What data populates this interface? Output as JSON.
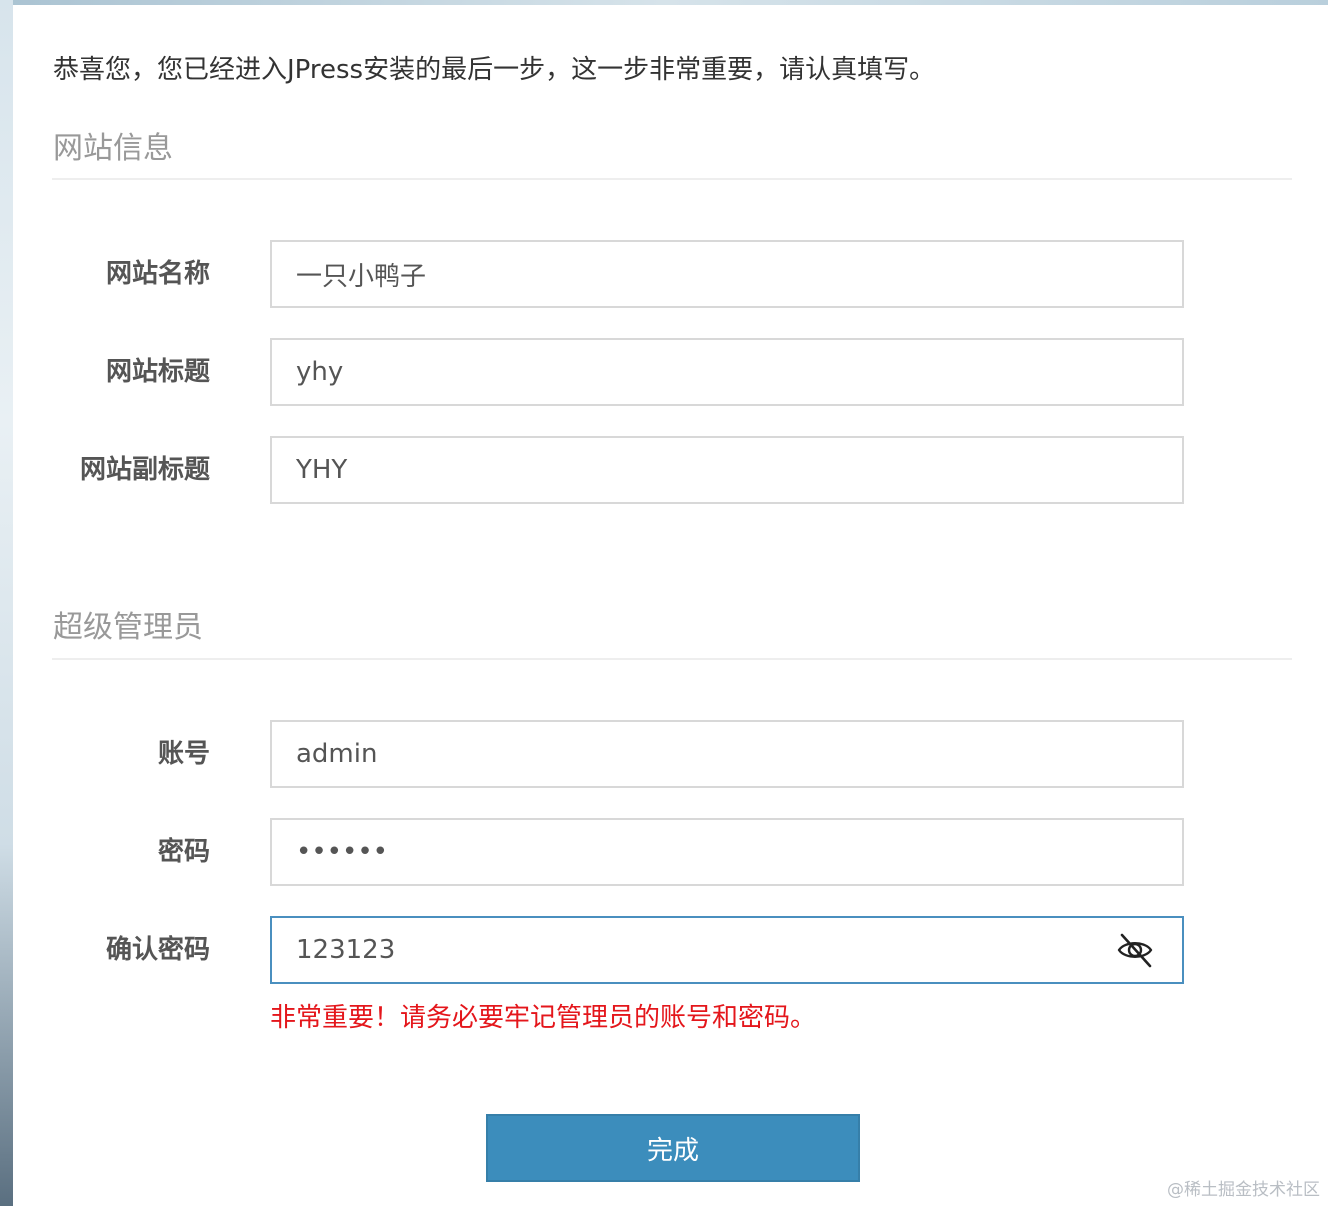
{
  "intro_text": "恭喜您，您已经进入JPress安装的最后一步，这一步非常重要，请认真填写。",
  "site_section": {
    "title": "网站信息",
    "fields": [
      {
        "label": "网站名称",
        "value": "一只小鸭子"
      },
      {
        "label": "网站标题",
        "value": "yhy"
      },
      {
        "label": "网站副标题",
        "value": "YHY"
      }
    ]
  },
  "admin_section": {
    "title": "超级管理员",
    "fields": [
      {
        "label": "账号",
        "value": "admin"
      },
      {
        "label": "密码",
        "value": "123123",
        "masked": true
      },
      {
        "label": "确认密码",
        "value": "123123",
        "masked": false
      }
    ],
    "confirm_toggle_icon": "eye-slash-icon"
  },
  "warning_text": "非常重要！请务必要牢记管理员的账号和密码。",
  "submit_label": "完成",
  "watermark": "@稀土掘金技术社区",
  "colors": {
    "accent": "#3c8dbc",
    "warning": "#e4161b",
    "focus_border": "#4a8fbf"
  }
}
